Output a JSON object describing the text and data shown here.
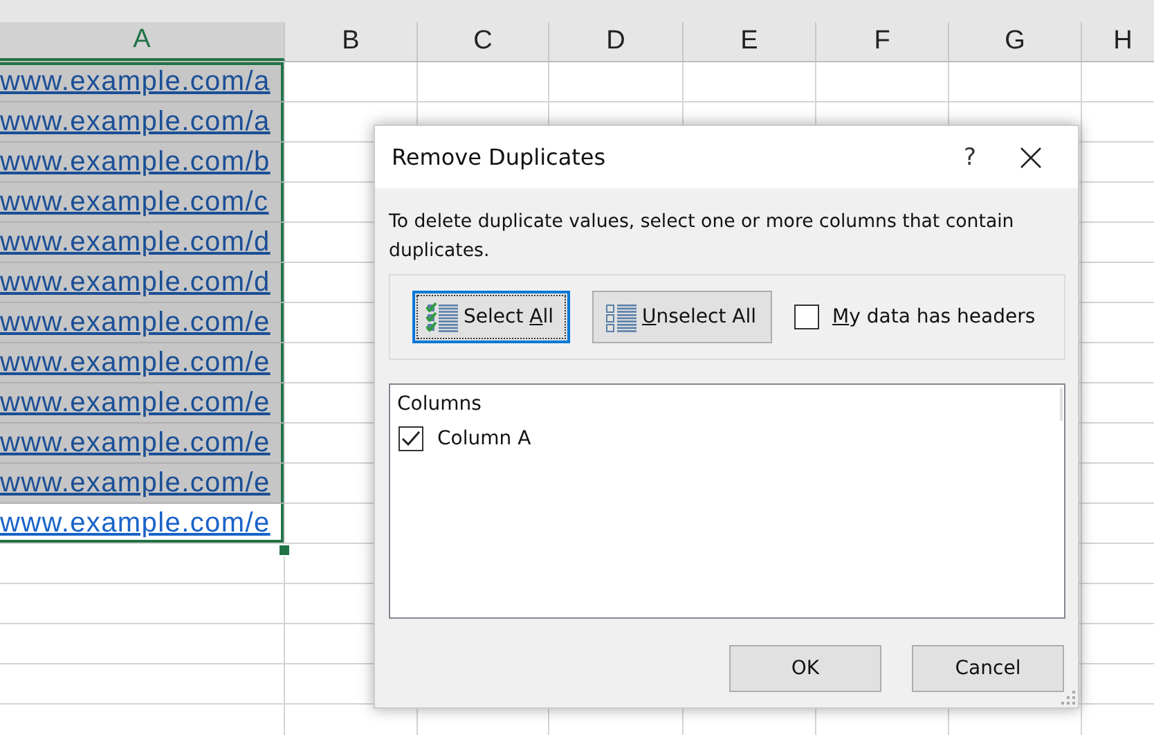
{
  "sheet": {
    "columns": [
      {
        "label": "A",
        "selected": true
      },
      {
        "label": "B",
        "selected": false
      },
      {
        "label": "C",
        "selected": false
      },
      {
        "label": "D",
        "selected": false
      },
      {
        "label": "E",
        "selected": false
      },
      {
        "label": "F",
        "selected": false
      },
      {
        "label": "G",
        "selected": false
      },
      {
        "label": "H",
        "selected": false
      }
    ],
    "cells": [
      {
        "text": "www.example.com/a",
        "highlighted": true
      },
      {
        "text": "www.example.com/a",
        "highlighted": true
      },
      {
        "text": "www.example.com/b",
        "highlighted": true
      },
      {
        "text": "www.example.com/c",
        "highlighted": true
      },
      {
        "text": "www.example.com/d",
        "highlighted": true
      },
      {
        "text": "www.example.com/d",
        "highlighted": true
      },
      {
        "text": "www.example.com/e",
        "highlighted": true
      },
      {
        "text": "www.example.com/e",
        "highlighted": true
      },
      {
        "text": "www.example.com/e",
        "highlighted": true
      },
      {
        "text": "www.example.com/e",
        "highlighted": true
      },
      {
        "text": "www.example.com/e",
        "highlighted": true
      },
      {
        "text": "www.example.com/e",
        "highlighted": false
      }
    ]
  },
  "dialog": {
    "title": "Remove Duplicates",
    "help": "?",
    "instructions": "To delete duplicate values, select one or more columns that contain duplicates.",
    "buttons": [
      {
        "kind": "select",
        "before": "Select ",
        "key": "A",
        "after": "ll",
        "focused": true
      },
      {
        "kind": "unselect",
        "key": "U",
        "after": "nselect All",
        "focused": false
      }
    ],
    "headers_option": {
      "key": "M",
      "after": "y data has headers",
      "checked": false
    },
    "columns_heading": "Columns",
    "columns": [
      {
        "label": "Column A",
        "checked": true
      }
    ],
    "actions": [
      "OK",
      "Cancel"
    ]
  }
}
